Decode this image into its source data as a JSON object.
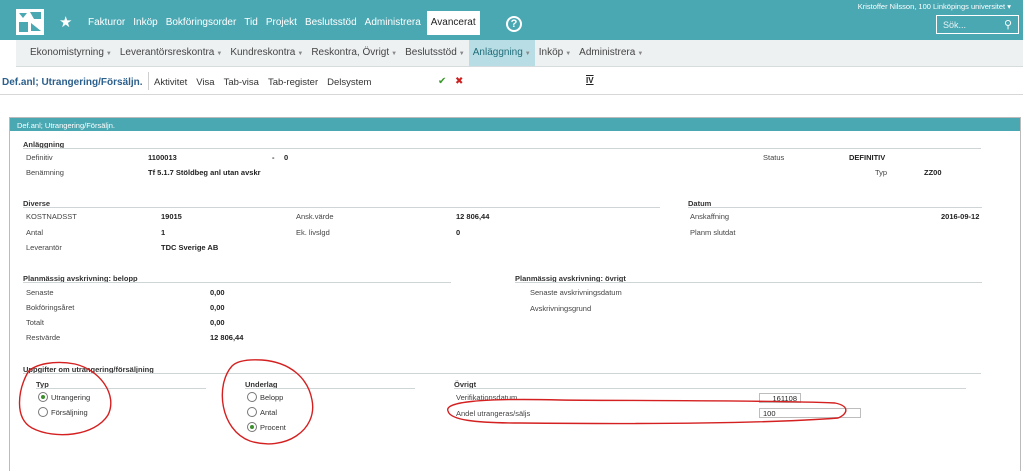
{
  "user": {
    "name": "Kristoffer Nilsson, 100 Linköpings universitet ▾"
  },
  "search": {
    "placeholder": "Sök..."
  },
  "main_nav": [
    {
      "label": "Fakturor",
      "active": false
    },
    {
      "label": "Inköp",
      "active": false
    },
    {
      "label": "Bokföringsorder",
      "active": false
    },
    {
      "label": "Tid",
      "active": false
    },
    {
      "label": "Projekt",
      "active": false
    },
    {
      "label": "Beslutsstöd",
      "active": false
    },
    {
      "label": "Administrera",
      "active": false
    },
    {
      "label": "Avancerat",
      "active": true
    }
  ],
  "sub_nav": [
    {
      "label": "Ekonomistyrning",
      "active": false
    },
    {
      "label": "Leverantörsreskontra",
      "active": false
    },
    {
      "label": "Kundreskontra",
      "active": false
    },
    {
      "label": "Reskontra, Övrigt",
      "active": false
    },
    {
      "label": "Beslutsstöd",
      "active": false
    },
    {
      "label": "Anläggning",
      "active": true
    },
    {
      "label": "Inköp",
      "active": false
    },
    {
      "label": "Administrera",
      "active": false
    }
  ],
  "toolbar": {
    "title": "Def.anl; Utrangering/Försäljn.",
    "tools": [
      "Aktivitet",
      "Visa",
      "Tab-visa",
      "Tab-register",
      "Delsystem"
    ],
    "ok": "✔",
    "cancel": "✖",
    "iv": "IV"
  },
  "panel": {
    "title": "Def.anl; Utrangering/Försäljn."
  },
  "anlaggning": {
    "heading": "Anläggning",
    "definitiv_label": "Definitiv",
    "definitiv_value": "1100013",
    "dash": "-",
    "definitiv_sub": "0",
    "benamning_label": "Benämning",
    "benamning_value": "Tf 5.1.7 Stöldbeg anl utan avskr",
    "status_label": "Status",
    "status_value": "DEFINITIV",
    "typ_label": "Typ",
    "typ_value": "ZZ00"
  },
  "diverse": {
    "heading": "Diverse",
    "kostnadsst_label": "KOSTNADSST",
    "kostnadsst_value": "19015",
    "antal_label": "Antal",
    "antal_value": "1",
    "leverantor_label": "Leverantör",
    "leverantor_value": "TDC Sverige AB",
    "ansk_label": "Ansk.värde",
    "ansk_value": "12 806,44",
    "ek_label": "Ek. livslgd",
    "ek_value": "0"
  },
  "datum": {
    "heading": "Datum",
    "anskaffning_label": "Anskaffning",
    "anskaffning_value": "2016-09-12",
    "planm_label": "Planm slutdat"
  },
  "avskr_belopp": {
    "heading": "Planmässig avskrivning: belopp",
    "rows": [
      {
        "label": "Senaste",
        "value": "0,00"
      },
      {
        "label": "Bokföringsåret",
        "value": "0,00"
      },
      {
        "label": "Totalt",
        "value": "0,00"
      },
      {
        "label": "Restvärde",
        "value": "12 806,44"
      }
    ]
  },
  "avskr_ovrigt": {
    "heading": "Planmässig avskrivning: övrigt",
    "senaste_label": "Senaste avskrivningsdatum",
    "grund_label": "Avskrivningsgrund"
  },
  "uppgifter": {
    "heading": "Uppgifter om utrangering/försäljning",
    "typ_heading": "Typ",
    "typ_options": [
      {
        "label": "Utrangering",
        "selected": true
      },
      {
        "label": "Försäljning",
        "selected": false
      }
    ],
    "underlag_heading": "Underlag",
    "underlag_options": [
      {
        "label": "Belopp",
        "selected": false
      },
      {
        "label": "Antal",
        "selected": false
      },
      {
        "label": "Procent",
        "selected": true
      }
    ],
    "ovrigt_heading": "Övrigt",
    "verifikationsdatum_label": "Verifikationsdatum",
    "verifikationsdatum_value": "161108",
    "andel_label": "Andel utrangeras/säljs",
    "andel_value": "100"
  },
  "annotation_color": "#d42020"
}
